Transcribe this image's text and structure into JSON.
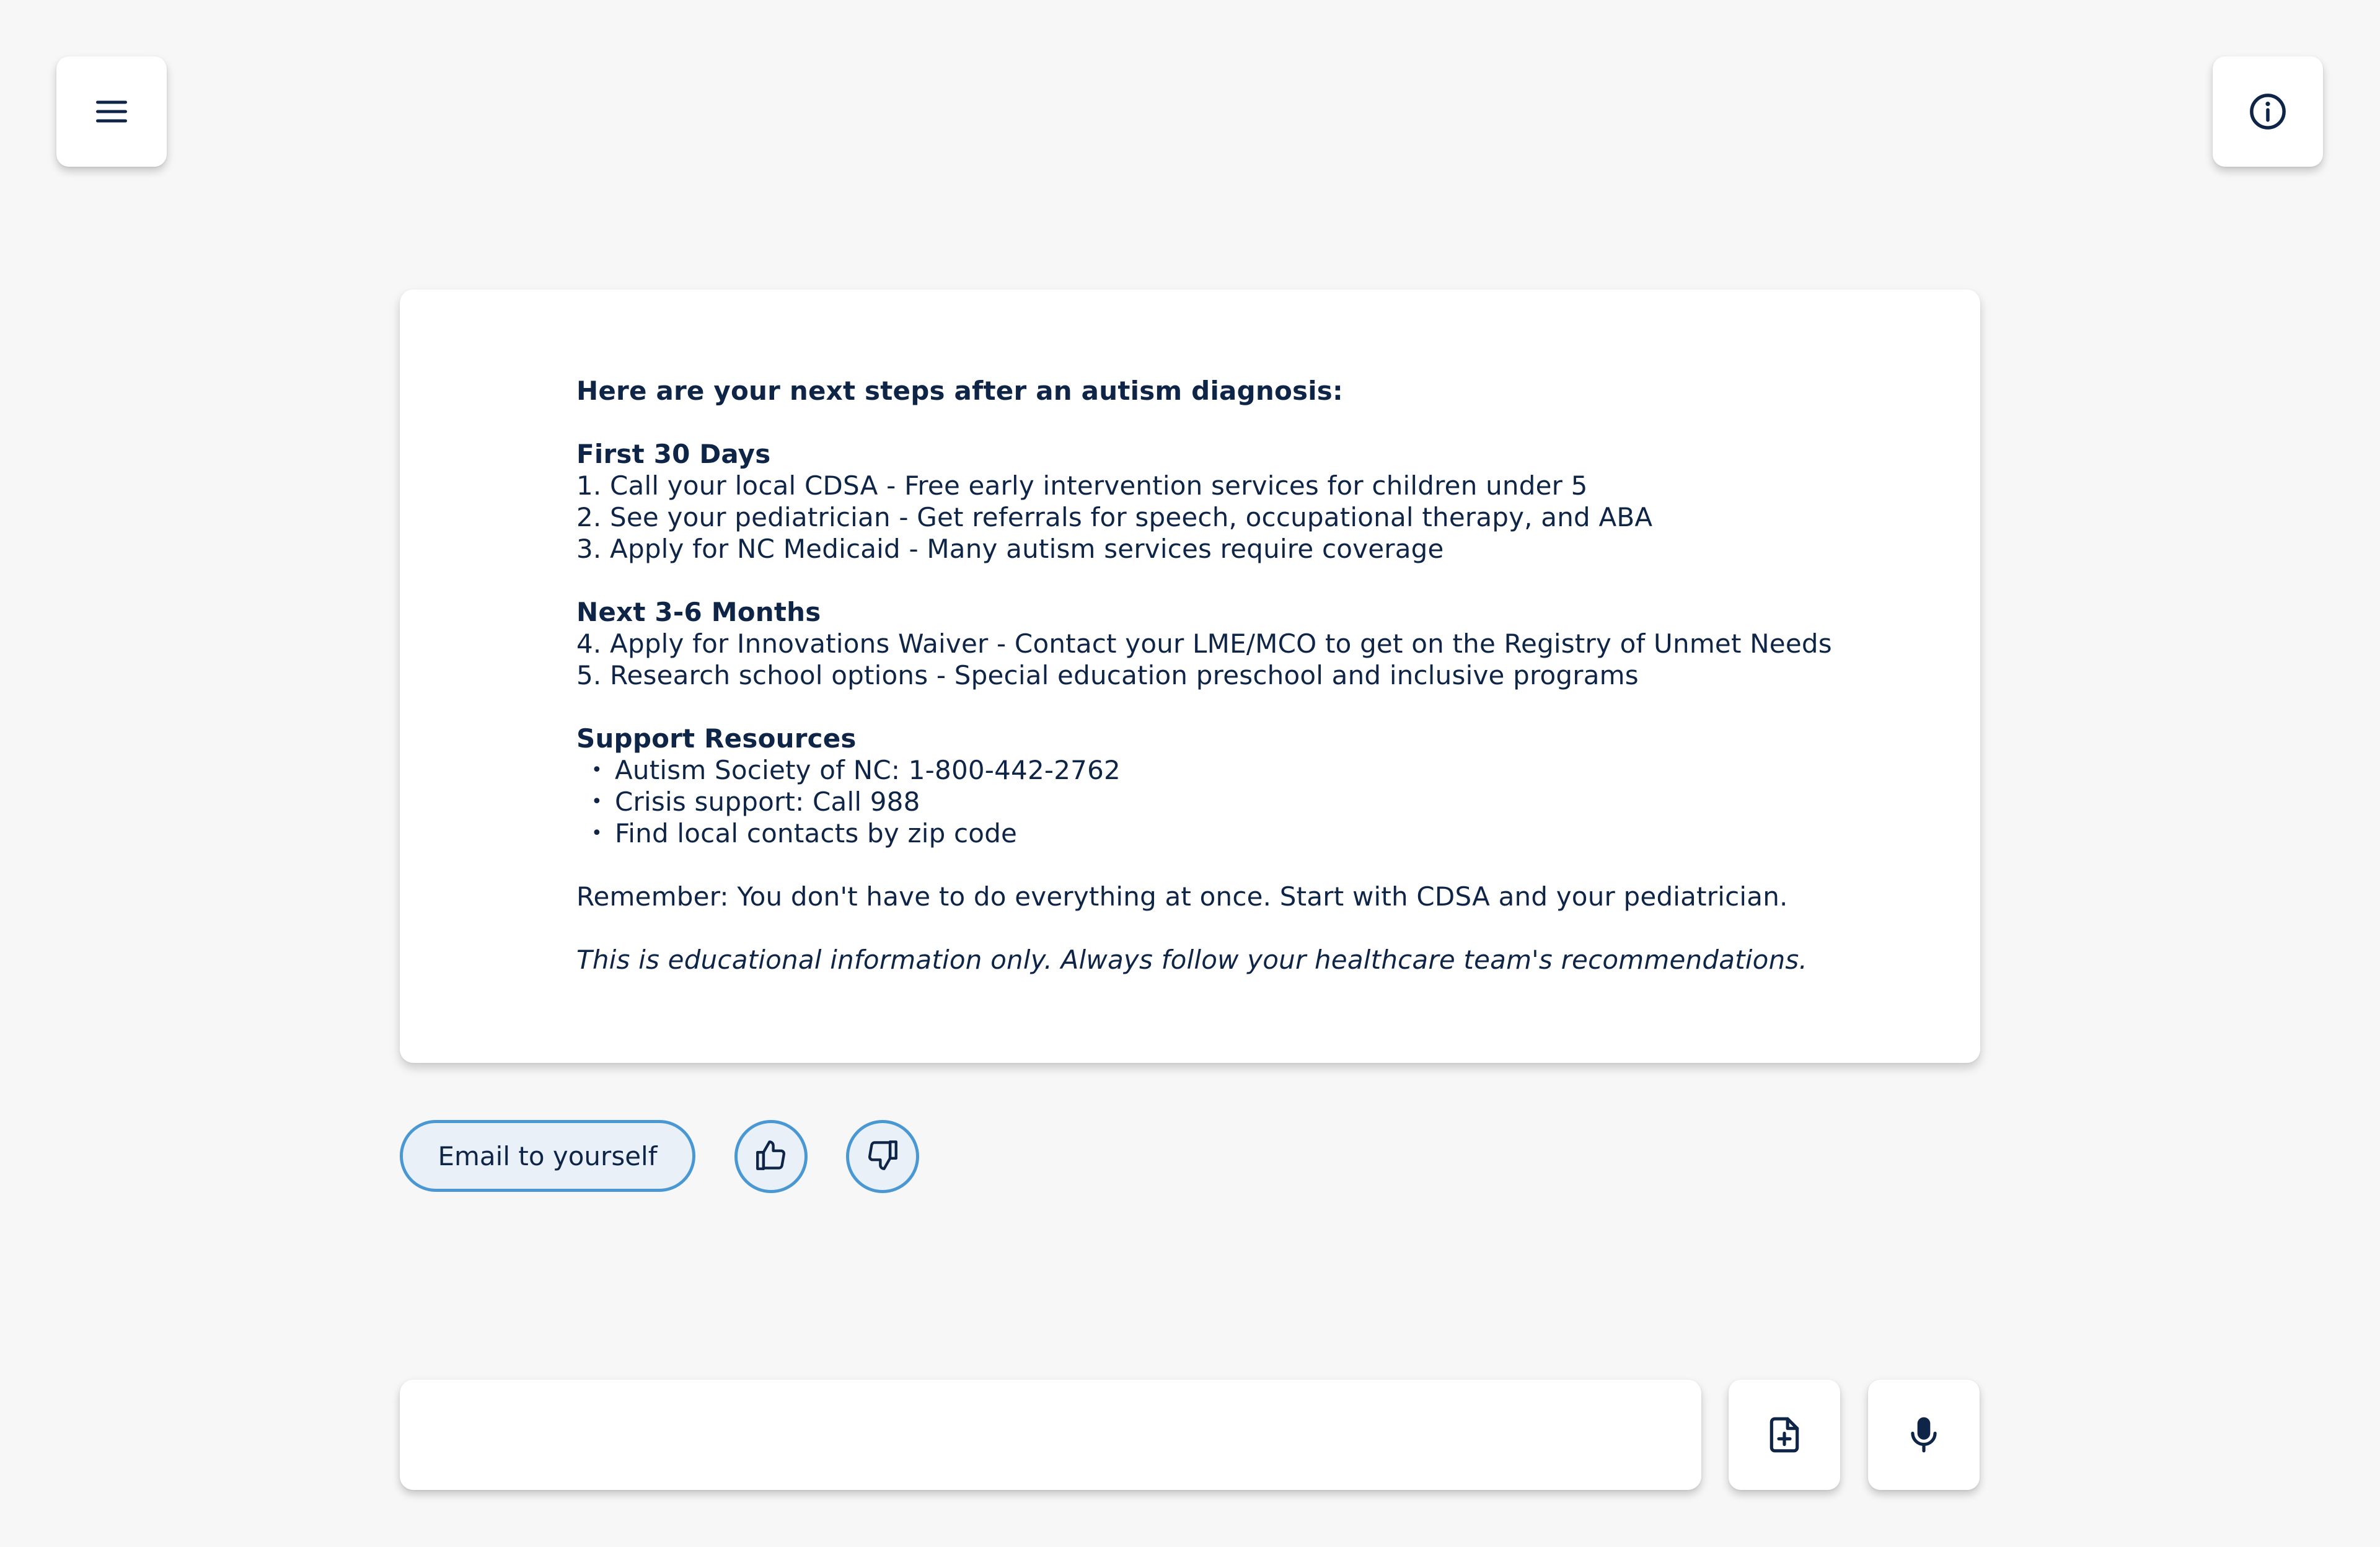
{
  "header": {
    "menu_icon": "hamburger-menu-icon",
    "info_icon": "info-circle-icon"
  },
  "response": {
    "intro": "Here are your next steps after an autism diagnosis:",
    "section1": {
      "title": "First 30 Days",
      "items": [
        "1. Call your local CDSA - Free early intervention services for children under 5",
        "2. See your pediatrician - Get referrals for speech, occupational therapy, and ABA",
        "3. Apply for NC Medicaid - Many autism services require coverage"
      ]
    },
    "section2": {
      "title": "Next 3-6 Months",
      "items": [
        "4. Apply for Innovations Waiver - Contact your LME/MCO to get on the Registry of Unmet Needs",
        "5. Research school options - Special education preschool and inclusive programs"
      ]
    },
    "section3": {
      "title": "Support Resources",
      "bullets": [
        "Autism Society of NC: 1-800-442-2762",
        "Crisis support: Call 988",
        "Find local contacts by zip code"
      ]
    },
    "reminder": "Remember: You don't have to do everything at once. Start with CDSA and your pediatrician.",
    "disclaimer": "This is educational information only. Always follow your healthcare team's recommendations."
  },
  "actions": {
    "email_label": "Email to yourself",
    "thumbs_up_icon": "thumbs-up-icon",
    "thumbs_down_icon": "thumbs-down-icon"
  },
  "composer": {
    "input_value": "",
    "input_placeholder": "",
    "attach_icon": "file-plus-icon",
    "mic_icon": "microphone-icon"
  },
  "colors": {
    "background": "#f7f7f7",
    "text": "#0f2547",
    "accent_border": "#4a98d3",
    "pill_fill": "#e9f0f7"
  }
}
